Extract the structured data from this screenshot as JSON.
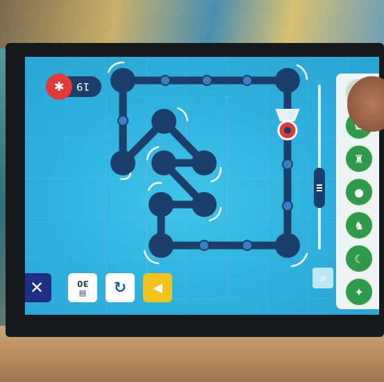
{
  "hud": {
    "counter_value": "19",
    "counter_icon": "drop-icon"
  },
  "toolbar": {
    "close_icon": "close-icon",
    "ruler_value": "30",
    "undo_icon": "undo-icon",
    "play_icon": "play-icon"
  },
  "palette": {
    "items": [
      {
        "icon": "rocket-icon"
      },
      {
        "icon": "leaf-icon"
      },
      {
        "icon": "castle-icon"
      },
      {
        "icon": "flame-icon"
      },
      {
        "icon": "animal-icon"
      },
      {
        "icon": "moon-icon"
      },
      {
        "icon": "bird-icon"
      }
    ],
    "expand_icon": "double-chevron-right-icon"
  },
  "colors": {
    "path": "#1c3e6a",
    "screen": "#2eb2df",
    "close_button": "#1e2f86",
    "play_button": "#f1c31c",
    "palette_green": "#2f9a4a",
    "drop_red": "#e23a36"
  }
}
